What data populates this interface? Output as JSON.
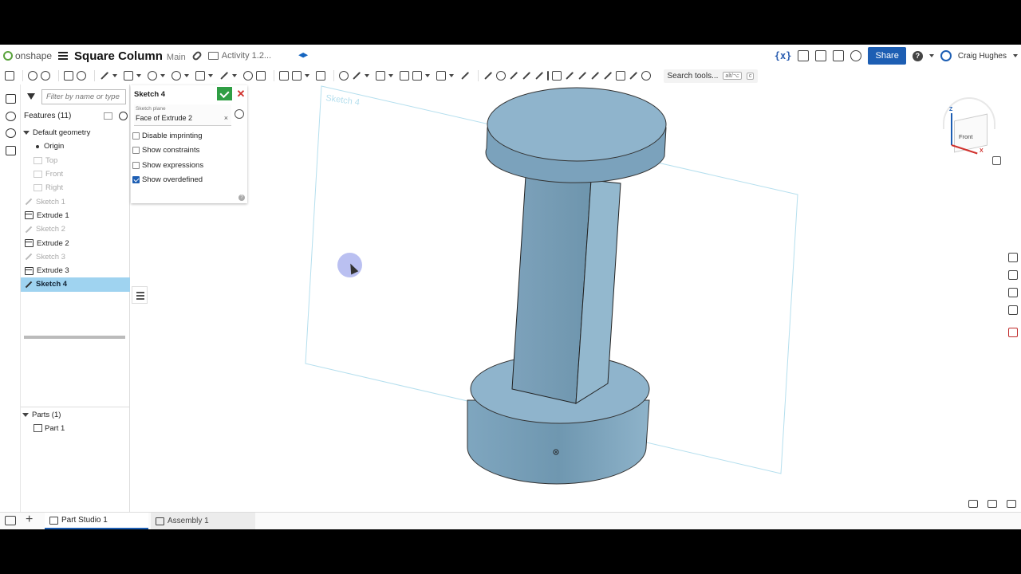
{
  "header": {
    "logo_text": "onshape",
    "doc_title": "Square Column",
    "branch": "Main",
    "folder_label": "Activity 1.2...",
    "share_label": "Share",
    "user_name": "Craig Hughes",
    "variables_icon": "{x}"
  },
  "toolbar": {
    "search_label": "Search tools...",
    "kbd_1": "alt/⌥",
    "kbd_2": "c"
  },
  "feature_panel": {
    "filter_placeholder": "Filter by name or type",
    "features_title": "Features (11)",
    "items": [
      {
        "label": "Default geometry",
        "kind": "group",
        "state": "normal"
      },
      {
        "label": "Origin",
        "kind": "origin",
        "state": "normal"
      },
      {
        "label": "Top",
        "kind": "plane",
        "state": "dim"
      },
      {
        "label": "Front",
        "kind": "plane",
        "state": "dim"
      },
      {
        "label": "Right",
        "kind": "plane",
        "state": "dim"
      },
      {
        "label": "Sketch 1",
        "kind": "sketch",
        "state": "dim"
      },
      {
        "label": "Extrude 1",
        "kind": "extrude",
        "state": "normal"
      },
      {
        "label": "Sketch 2",
        "kind": "sketch",
        "state": "dim"
      },
      {
        "label": "Extrude 2",
        "kind": "extrude",
        "state": "normal"
      },
      {
        "label": "Sketch 3",
        "kind": "sketch",
        "state": "dim"
      },
      {
        "label": "Extrude 3",
        "kind": "extrude",
        "state": "normal"
      },
      {
        "label": "Sketch 4",
        "kind": "sketch",
        "state": "selected"
      }
    ],
    "parts_title": "Parts (1)",
    "parts": [
      "Part 1"
    ]
  },
  "sketch_dialog": {
    "title": "Sketch 4",
    "plane_label": "Sketch plane",
    "plane_value": "Face of Extrude 2",
    "plane_clear": "×",
    "close_glyph": "✕",
    "help_glyph": "?",
    "options": [
      {
        "label": "Disable imprinting",
        "checked": false
      },
      {
        "label": "Show constraints",
        "checked": false
      },
      {
        "label": "Show expressions",
        "checked": false
      },
      {
        "label": "Show overdefined",
        "checked": true
      }
    ]
  },
  "viewport": {
    "sketch_label": "Sketch 4",
    "model_color": "#8fb4cc",
    "sketch_plane_color": "#9fd3e6"
  },
  "viewcube": {
    "face_label": "Front",
    "z_label": "Z",
    "x_label": "X"
  },
  "tabs": [
    {
      "label": "Part Studio 1",
      "active": true
    },
    {
      "label": "Assembly 1",
      "active": false
    }
  ],
  "colors": {
    "accent": "#1d5eb3",
    "selected_row": "#9fd3f0",
    "confirm_green": "#2f9e44",
    "cancel_red": "#d0312d"
  }
}
